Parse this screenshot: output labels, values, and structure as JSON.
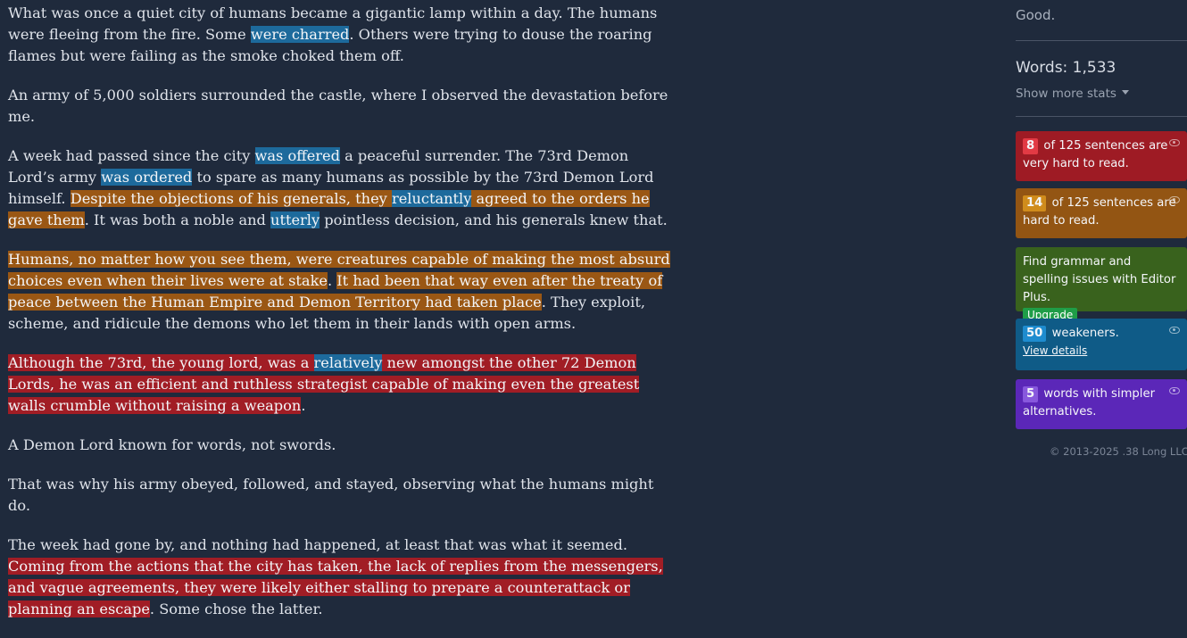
{
  "editor": {
    "p1": {
      "a": "What was once a quiet city of humans became a gigantic lamp within a day. The humans were fleeing from the fire. Some ",
      "b": "were charred",
      "c": ". Others were trying to douse the roaring flames but were failing as the smoke choked them off."
    },
    "p2": "An army of 5,000 soldiers surrounded the castle, where I observed the devastation before me.",
    "p3": {
      "a": "A week had passed since the city ",
      "b": "was offered",
      "c": " a peaceful surrender. The 73rd Demon Lord’s army ",
      "d": "was ordered",
      "e": " to spare as many humans as possible by the 73rd Demon Lord himself. ",
      "f": "Despite the objections of his generals, they ",
      "g": "reluctantly",
      "h": " agreed to the orders he gave them",
      "i": ". It was both a noble and ",
      "j": "utterly",
      "k": " pointless decision, and his generals knew that."
    },
    "p4": {
      "a": "Humans, no matter how you see them, were creatures capable of making the most absurd choices even when their lives were at stake",
      "b": ". ",
      "c": "It had been that way even after the treaty of peace between the Human Empire and Demon Territory had taken place",
      "d": ". They exploit, scheme, and ridicule the demons who let them in their lands with open arms."
    },
    "p5": {
      "a": "Although the 73rd, the young lord, was a ",
      "b": "relatively",
      "c": " new amongst the other 72 Demon Lords, he was an efficient and ruthless strategist capable of making even the greatest walls crumble without raising a weapon",
      "d": "."
    },
    "p6": "A Demon Lord known for words, not swords.",
    "p7": "That was why his army obeyed, followed, and stayed, observing what the humans might do.",
    "p8": {
      "a": "The week had gone by, and nothing had happened, at least that was what it seemed. ",
      "b": "Coming from the actions that the city has taken, the lack of replies from the messengers, and vague agreements, they were likely either stalling to prepare a counterattack or planning an escape",
      "c": ". Some chose the latter."
    }
  },
  "sidebar": {
    "grade": "Good.",
    "words": "Words: 1,533",
    "show_more": "Show more stats",
    "very_hard": {
      "count": "8",
      "text": "of 125 sentences are very hard to read."
    },
    "hard": {
      "count": "14",
      "text": "of 125 sentences are hard to read."
    },
    "upsell": {
      "text": "Find grammar and spelling issues with Editor Plus.",
      "button": "Upgrade"
    },
    "weakeners": {
      "count": "50",
      "text": "weakeners.",
      "link": "View details"
    },
    "simpler": {
      "count": "5",
      "text": "words with simpler alternatives."
    },
    "copyright": "© 2013-2025 .38 Long LLC"
  },
  "colors": {
    "background": "#1f2a3c",
    "very_hard": "#9e1b24",
    "hard": "#935513",
    "upsell": "#39621d",
    "weakeners": "#0f5b87",
    "simpler": "#5b27b8"
  }
}
